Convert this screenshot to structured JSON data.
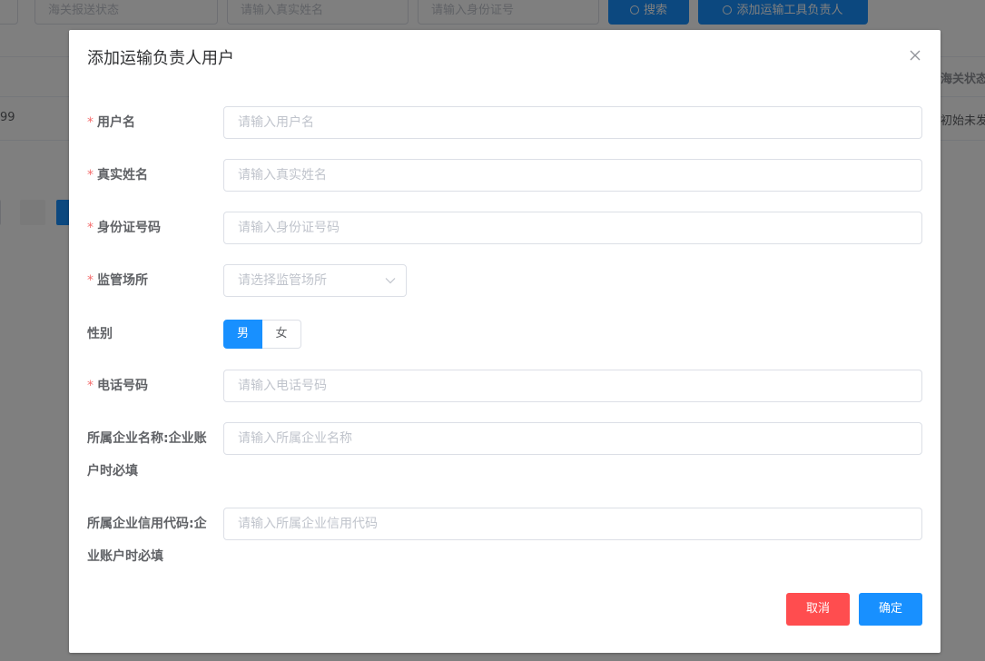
{
  "background": {
    "filters": [
      {
        "placeholder": "海关报送状态"
      },
      {
        "placeholder": "请输入真实姓名"
      },
      {
        "placeholder": "请输入身份证号"
      }
    ],
    "search_label": "搜索",
    "add_label": "添加运输工具负责人",
    "table_header_last": "海关状态",
    "row_first_cell": "99",
    "row_last_cell": "初始未发送"
  },
  "dialog": {
    "title": "添加运输负责人用户",
    "required_mark": "*",
    "fields": {
      "username": {
        "label": "用户名",
        "placeholder": "请输入用户名"
      },
      "realname": {
        "label": "真实姓名",
        "placeholder": "请输入真实姓名"
      },
      "idcard": {
        "label": "身份证号码",
        "placeholder": "请输入身份证号码"
      },
      "site": {
        "label": "监管场所",
        "placeholder": "请选择监管场所"
      },
      "gender": {
        "label": "性别",
        "options": [
          "男",
          "女"
        ],
        "selected": "男"
      },
      "phone": {
        "label": "电话号码",
        "placeholder": "请输入电话号码"
      },
      "company_name": {
        "label": "所属企业名称:企业账户时必填",
        "placeholder": "请输入所属企业名称"
      },
      "credit_code": {
        "label": "所属企业信用代码:企业账户时必填",
        "placeholder": "请输入所属企业信用代码"
      }
    },
    "cancel_label": "取消",
    "confirm_label": "确定"
  },
  "colors": {
    "primary": "#1890ff",
    "danger": "#ff4d4f",
    "required": "#f56c6c"
  }
}
